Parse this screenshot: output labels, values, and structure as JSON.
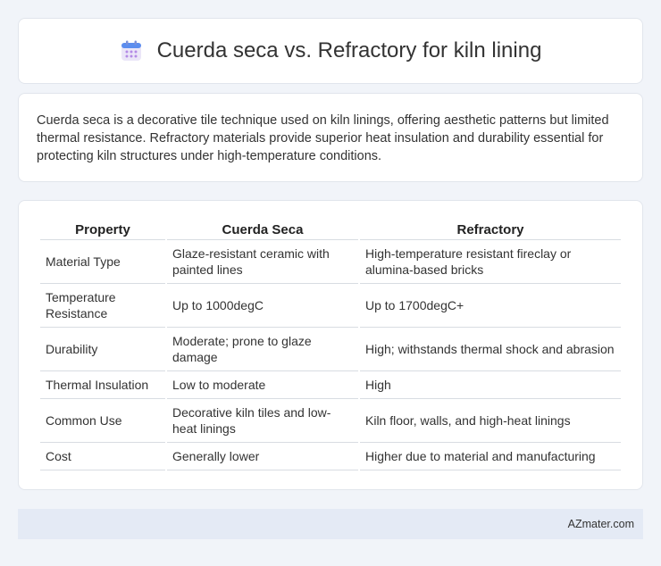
{
  "header": {
    "title": "Cuerda seca vs. Refractory for kiln lining",
    "icon": "calendar-icon",
    "icon_colors": {
      "top": "#5b8def",
      "body": "#e9e4f7",
      "dots": "#b48be6"
    }
  },
  "intro": {
    "text": "Cuerda seca is a decorative tile technique used on kiln linings, offering aesthetic patterns but limited thermal resistance. Refractory materials provide superior heat insulation and durability essential for protecting kiln structures under high-temperature conditions."
  },
  "table": {
    "headers": [
      "Property",
      "Cuerda Seca",
      "Refractory"
    ],
    "rows": [
      [
        "Material Type",
        "Glaze-resistant ceramic with painted lines",
        "High-temperature resistant fireclay or alumina-based bricks"
      ],
      [
        "Temperature Resistance",
        "Up to 1000degC",
        "Up to 1700degC+"
      ],
      [
        "Durability",
        "Moderate; prone to glaze damage",
        "High; withstands thermal shock and abrasion"
      ],
      [
        "Thermal Insulation",
        "Low to moderate",
        "High"
      ],
      [
        "Common Use",
        "Decorative kiln tiles and low-heat linings",
        "Kiln floor, walls, and high-heat linings"
      ],
      [
        "Cost",
        "Generally lower",
        "Higher due to material and manufacturing"
      ]
    ]
  },
  "footer": {
    "brand": "AZmater.com"
  }
}
